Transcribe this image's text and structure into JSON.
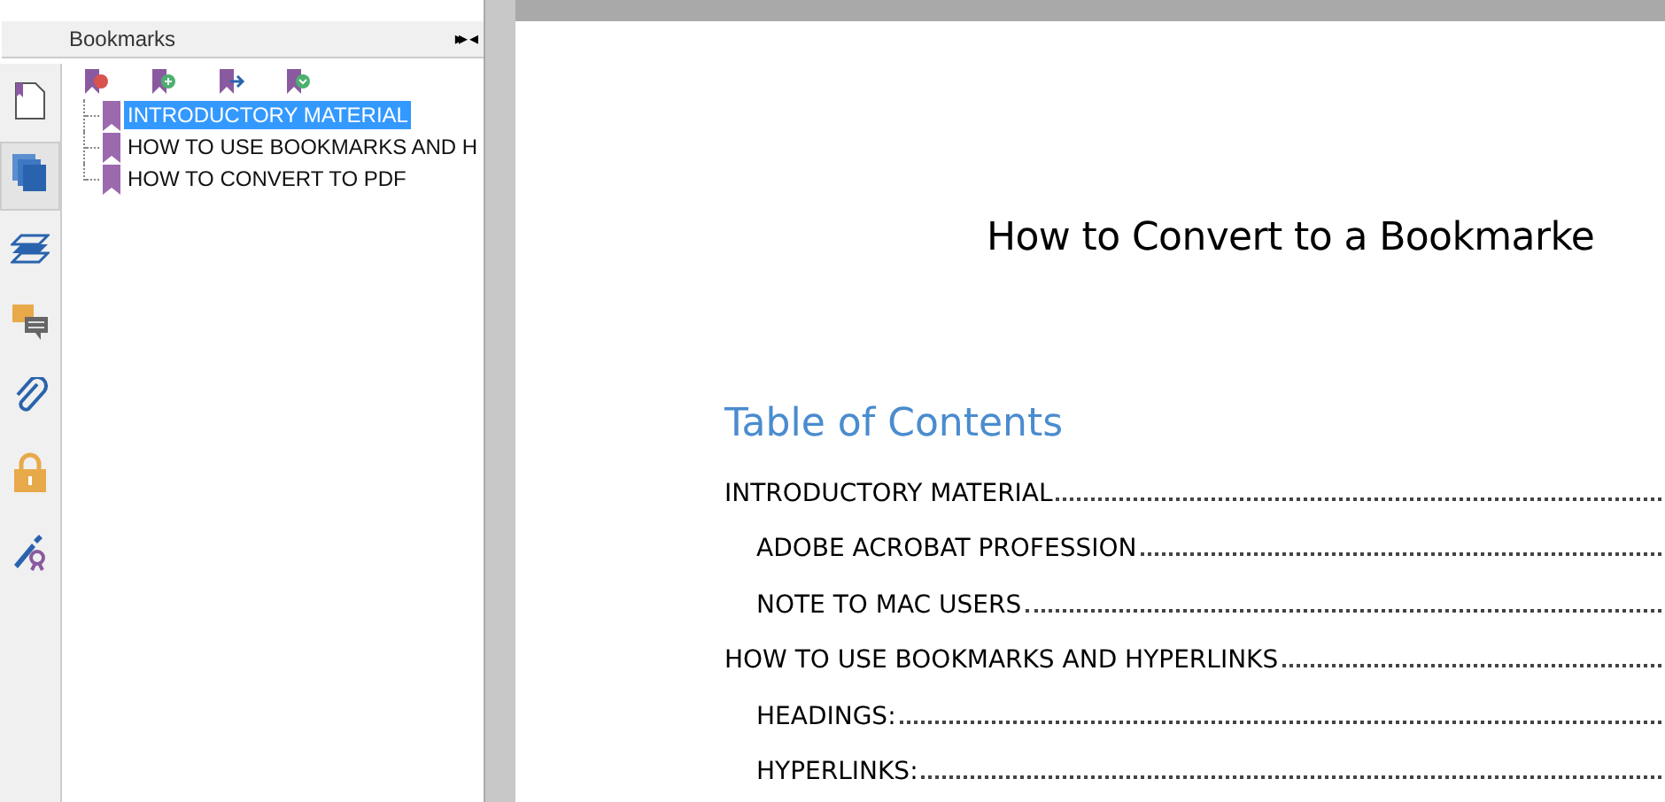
{
  "bookmarks_panel": {
    "title": "Bookmarks",
    "header_buttons": [
      "▸▸",
      "◂"
    ],
    "items": [
      {
        "label": "INTRODUCTORY MATERIAL",
        "selected": true
      },
      {
        "label": "HOW TO USE BOOKMARKS AND H",
        "selected": false
      },
      {
        "label": "HOW TO CONVERT TO PDF",
        "selected": false
      }
    ]
  },
  "document": {
    "title": "How to Convert to a Bookmarke",
    "toc_heading": "Table of Contents",
    "toc": [
      {
        "text": "INTRODUCTORY MATERIAL",
        "indented": false
      },
      {
        "text": "ADOBE ACROBAT PROFESSION",
        "indented": true
      },
      {
        "text": "NOTE TO MAC USERS",
        "indented": true
      },
      {
        "text": "HOW TO USE BOOKMARKS AND HYPERLINKS",
        "indented": false
      },
      {
        "text": "HEADINGS:",
        "indented": true
      },
      {
        "text": "HYPERLINKS:",
        "indented": true
      }
    ]
  }
}
